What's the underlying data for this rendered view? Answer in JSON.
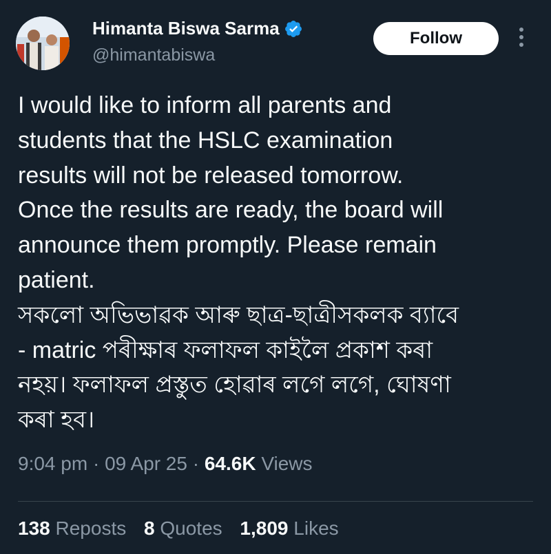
{
  "author": {
    "name": "Himanta Biswa Sarma",
    "handle": "@himantabiswa",
    "verified_color": "#1d9bf0"
  },
  "follow_label": "Follow",
  "tweet_lines": [
    "I would like to inform all parents and",
    "students that the HSLC examination",
    "results will not be released tomorrow.",
    "Once the results are ready, the board will",
    "announce them promptly. Please remain",
    "patient.",
    "সকলো অভিভাৱক আৰু ছাত্ৰ-ছাত্ৰীসকলক ব্যাবে",
    "- matric পৰীক্ষাৰ ফলাফল কাইলৈ প্ৰকাশ কৰা",
    "নহয়। ফলাফল প্ৰস্তুত হোৱাৰ লগে লগে, ঘোষণা",
    "কৰা হব।"
  ],
  "meta": {
    "time": "9:04 pm",
    "date": "09 Apr 25",
    "views_count": "64.6K",
    "views_label": "Views"
  },
  "stats": {
    "reposts_count": "138",
    "reposts_label": "Reposts",
    "quotes_count": "8",
    "quotes_label": "Quotes",
    "likes_count": "1,809",
    "likes_label": "Likes"
  },
  "colors": {
    "background": "#15202b",
    "text": "#f7f9f9",
    "secondary": "#8b98a5"
  }
}
